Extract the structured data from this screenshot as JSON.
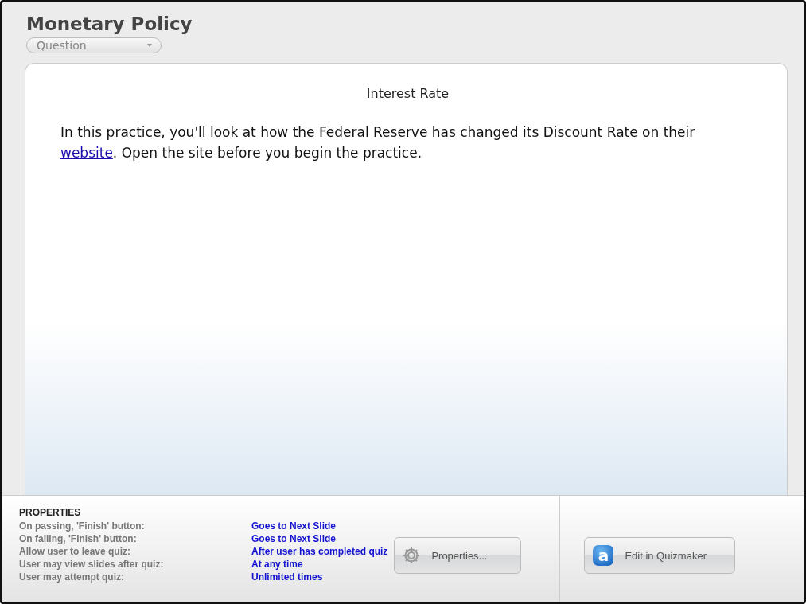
{
  "title": "Monetary Policy",
  "slide_type": {
    "value": "Question"
  },
  "slide": {
    "heading": "Interest Rate",
    "text_before": "In this practice, you'll look at how the Federal Reserve has changed its Discount Rate on their ",
    "link": "website",
    "text_after": ". Open the site before you begin the practice."
  },
  "properties": {
    "heading": "PROPERTIES",
    "rows": [
      {
        "label": "On passing, 'Finish' button:",
        "value": "Goes to Next Slide"
      },
      {
        "label": "On failing, 'Finish' button:",
        "value": "Goes to Next Slide"
      },
      {
        "label": "Allow user to leave quiz:",
        "value": "After user has completed quiz"
      },
      {
        "label": "User may view slides after quiz:",
        "value": "At any time"
      },
      {
        "label": "User may attempt quiz:",
        "value": "Unlimited times"
      }
    ]
  },
  "buttons": {
    "properties": "Properties...",
    "edit": {
      "label": "Edit in Quizmaker",
      "icon_letter": "a"
    }
  }
}
